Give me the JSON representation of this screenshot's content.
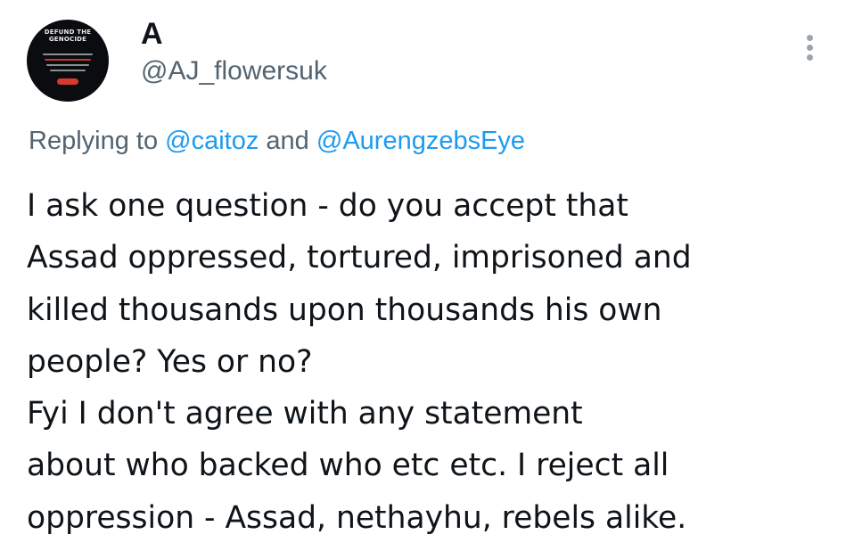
{
  "tweet": {
    "avatar_text": {
      "line1": "DEFUND THE",
      "line2": "GENOCIDE"
    },
    "display_name": "A",
    "handle": "@AJ_flowersuk",
    "replying_prefix": "Replying to",
    "replying_users": [
      "@caitoz",
      "@AurengzebsEye"
    ],
    "replying_joiner": "and",
    "body_lines": [
      "I ask one question - do you accept that",
      "Assad oppressed, tortured, imprisoned and",
      "killed thousands upon thousands his own",
      "people? Yes or no?",
      "Fyi I don't agree with any statement",
      "about who backed who etc etc. I reject all",
      "oppression - Assad, nethayhu, rebels alike."
    ]
  },
  "colors": {
    "text": "#0f1419",
    "secondary": "#536471",
    "link": "#1d9bf0",
    "avatar_bg": "#0b0c10",
    "avatar_button": "#d63a2f"
  },
  "icons": {
    "more": "vertical-ellipsis"
  }
}
